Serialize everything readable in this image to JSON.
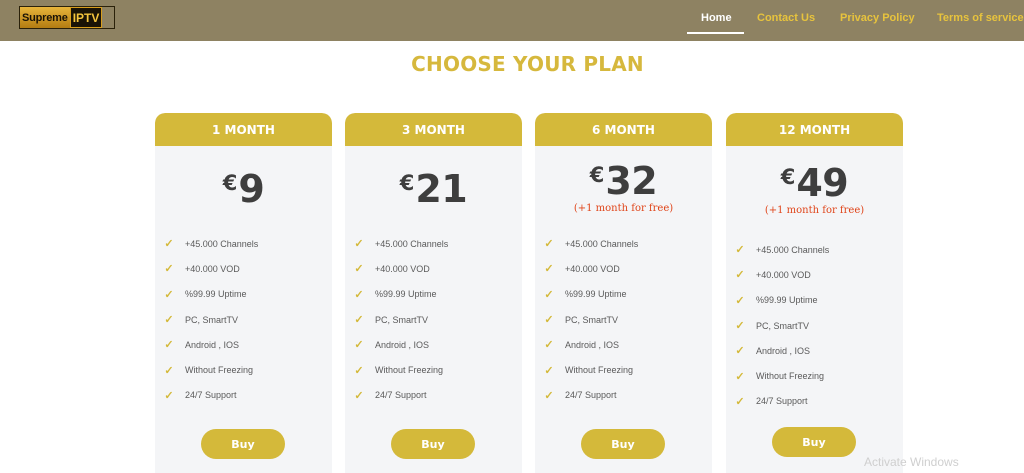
{
  "logo": {
    "part1": "Supreme",
    "part2": "IPTV"
  },
  "nav": [
    {
      "label": "Home",
      "active": true
    },
    {
      "label": "Contact Us",
      "active": false
    },
    {
      "label": "Privacy Policy",
      "active": false
    },
    {
      "label": "Terms of service",
      "active": false
    }
  ],
  "page_title": "CHOOSE YOUR PLAN",
  "plans": [
    {
      "name": "1 MONTH",
      "currency": "€",
      "price": "9",
      "promo": "",
      "features": [
        "+45.000 Channels",
        "+40.000 VOD",
        "%99.99 Uptime",
        "PC, SmartTV",
        "Android , IOS",
        "Without Freezing",
        "24/7 Support"
      ],
      "button": "Buy"
    },
    {
      "name": "3 MONTH",
      "currency": "€",
      "price": "21",
      "promo": "",
      "features": [
        "+45.000 Channels",
        "+40.000 VOD",
        "%99.99 Uptime",
        "PC, SmartTV",
        "Android , IOS",
        "Without Freezing",
        "24/7 Support"
      ],
      "button": "Buy"
    },
    {
      "name": "6 MONTH",
      "currency": "€",
      "price": "32",
      "promo": "(+1 month for free)",
      "features": [
        "+45.000 Channels",
        "+40.000 VOD",
        "%99.99 Uptime",
        "PC, SmartTV",
        "Android , IOS",
        "Without Freezing",
        "24/7 Support"
      ],
      "button": "Buy"
    },
    {
      "name": "12 MONTH",
      "currency": "€",
      "price": "49",
      "promo": "(+1 month for free)",
      "features": [
        "+45.000 Channels",
        "+40.000 VOD",
        "%99.99 Uptime",
        "PC, SmartTV",
        "Android , IOS",
        "Without Freezing",
        "24/7 Support"
      ],
      "button": "Buy"
    }
  ],
  "check_icon": "check-icon",
  "colors": {
    "header": "#8e8262",
    "accent": "#d4b93a",
    "nav_link": "#e7c33d",
    "promo": "#e0451a"
  },
  "watermark": "Activate Windows"
}
